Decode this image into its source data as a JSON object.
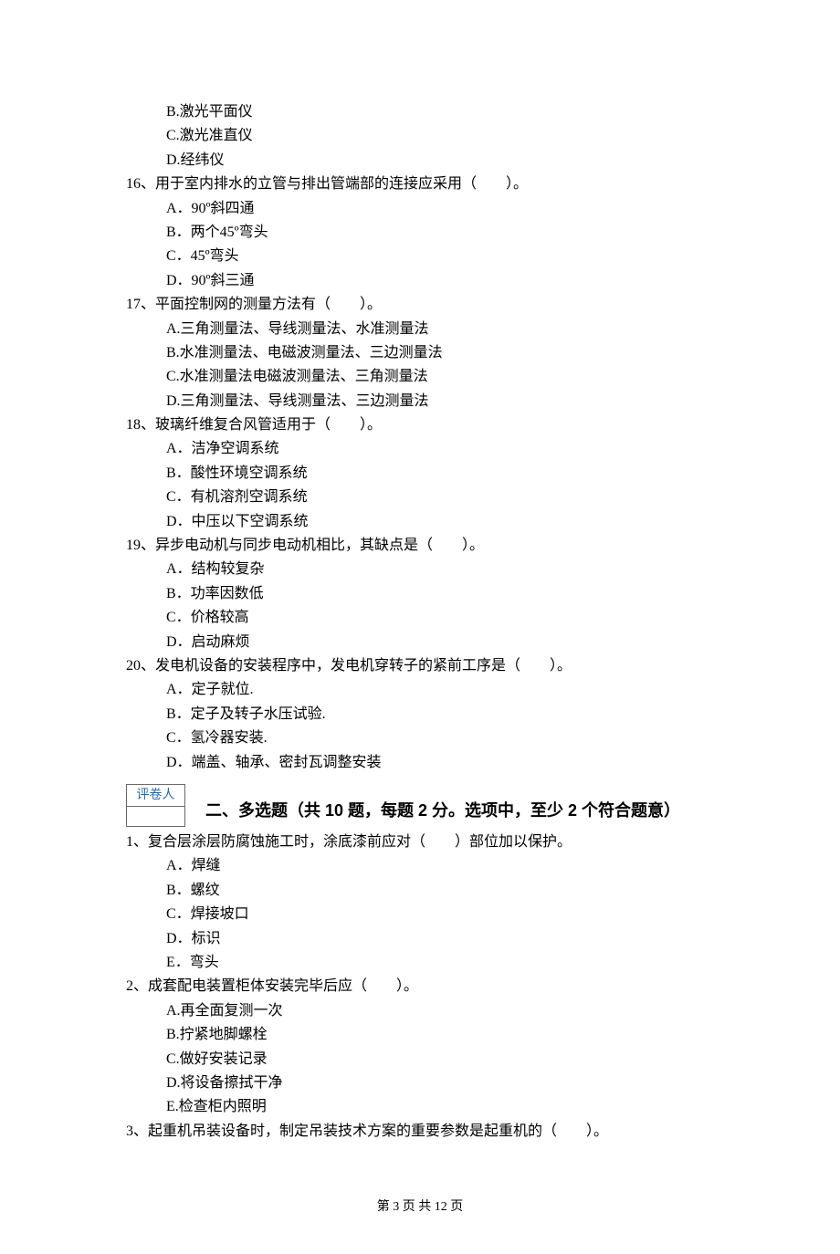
{
  "q15_opts": {
    "b": "B.激光平面仪",
    "c": "C.激光准直仪",
    "d": "D.经纬仪"
  },
  "q16": {
    "stem": "16、用于室内排水的立管与排出管端部的连接应采用（　　）。",
    "a": "A．90º斜四通",
    "b": "B．两个45º弯头",
    "c": "C．45º弯头",
    "d": "D．90º斜三通"
  },
  "q17": {
    "stem": "17、平面控制网的测量方法有（　　）。",
    "a": "A.三角测量法、导线测量法、水准测量法",
    "b": "B.水准测量法、电磁波测量法、三边测量法",
    "c": "C.水准测量法电磁波测量法、三角测量法",
    "d": "D.三角测量法、导线测量法、三边测量法"
  },
  "q18": {
    "stem": "18、玻璃纤维复合风管适用于（　　）。",
    "a": "A．洁净空调系统",
    "b": "B．酸性环境空调系统",
    "c": "C．有机溶剂空调系统",
    "d": "D．中压以下空调系统"
  },
  "q19": {
    "stem": "19、异步电动机与同步电动机相比，其缺点是（　　）。",
    "a": "A．结构较复杂",
    "b": "B．功率因数低",
    "c": "C．价格较高",
    "d": "D．启动麻烦"
  },
  "q20": {
    "stem": "20、发电机设备的安装程序中，发电机穿转子的紧前工序是（　　）。",
    "a": "A．定子就位.",
    "b": "B．定子及转子水压试验.",
    "c": "C．氢冷器安装.",
    "d": "D．端盖、轴承、密封瓦调整安装"
  },
  "grader_label": "评卷人",
  "section2_title": "二、多选题（共 10 题，每题 2 分。选项中，至少 2 个符合题意）",
  "m1": {
    "stem": "1、复合层涂层防腐蚀施工时，涂底漆前应对（　　）部位加以保护。",
    "a": "A．焊缝",
    "b": "B．螺纹",
    "c": "C．焊接坡口",
    "d": "D．标识",
    "e": "E．弯头"
  },
  "m2": {
    "stem": "2、成套配电装置柜体安装完毕后应（　　）。",
    "a": "A.再全面复测一次",
    "b": "B.拧紧地脚螺栓",
    "c": "C.做好安装记录",
    "d": "D.将设备擦拭干净",
    "e": "E.检查柜内照明"
  },
  "m3": {
    "stem": "3、起重机吊装设备时，制定吊装技术方案的重要参数是起重机的（　　）。"
  },
  "footer": "第 3 页 共 12 页"
}
